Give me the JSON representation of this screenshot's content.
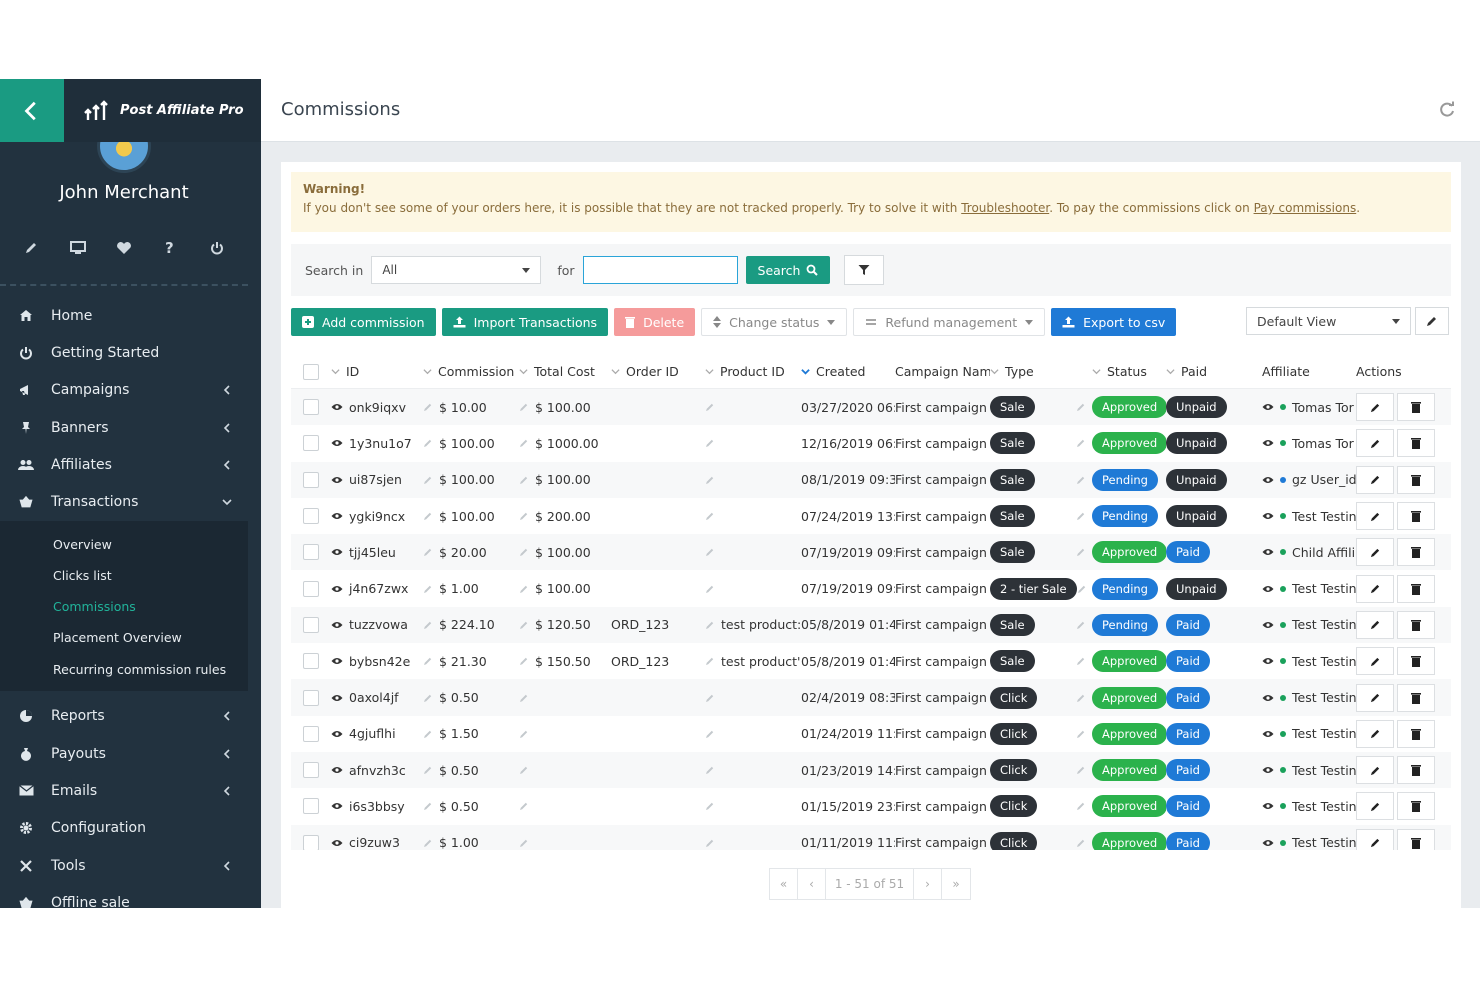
{
  "sidebar": {
    "logo_text": "Post Affiliate Pro",
    "user_name": "John Merchant",
    "menu": [
      {
        "label": "Home",
        "icon": "home-icon"
      },
      {
        "label": "Getting Started",
        "icon": "power-circle-icon"
      },
      {
        "label": "Campaigns",
        "icon": "megaphone-icon"
      },
      {
        "label": "Banners",
        "icon": "pin-icon"
      },
      {
        "label": "Affiliates",
        "icon": "users-icon"
      },
      {
        "label": "Transactions",
        "icon": "basket-icon"
      }
    ],
    "submenu": [
      "Overview",
      "Clicks list",
      "Commissions",
      "Placement Overview",
      "Recurring commission rules"
    ],
    "menu_after": [
      {
        "label": "Reports",
        "icon": "pie-icon"
      },
      {
        "label": "Payouts",
        "icon": "moneybag-icon"
      },
      {
        "label": "Emails",
        "icon": "envelope-icon"
      },
      {
        "label": "Configuration",
        "icon": "gear-icon"
      },
      {
        "label": "Tools",
        "icon": "tools-icon"
      },
      {
        "label": "Offline sale",
        "icon": "basket-icon"
      }
    ]
  },
  "header": {
    "title": "Commissions"
  },
  "warning": {
    "title": "Warning!",
    "text_before": "If you don't see some of your orders here, it is possible that they are not tracked properly. Try to solve it with ",
    "link1": "Troubleshooter",
    "text_middle": ". To pay the commissions click on ",
    "link2": "Pay commissions",
    "text_after": "."
  },
  "search": {
    "search_in_label": "Search in",
    "search_in_value": "All",
    "for_label": "for",
    "input_value": "",
    "button_label": "Search"
  },
  "toolbar": {
    "add": "Add commission",
    "import": "Import Transactions",
    "delete": "Delete",
    "change_status": "Change status",
    "refund": "Refund management",
    "export": "Export to csv",
    "view": "Default View"
  },
  "table": {
    "headers": [
      "ID",
      "Commission",
      "Total Cost",
      "Order ID",
      "Product ID",
      "Created",
      "Campaign Nam",
      "Type",
      "Status",
      "Paid",
      "Affiliate",
      "Actions"
    ],
    "rows": [
      {
        "id": "onk9iqxv",
        "commission": "$ 10.00",
        "total_cost": "$ 100.00",
        "order_id": "",
        "product_id": "",
        "created": "03/27/2020 06::",
        "campaign": "First campaign",
        "type": "Sale",
        "status": "Approved",
        "paid": "Unpaid",
        "affiliate": "Tomas Tor",
        "aff_dot": "g"
      },
      {
        "id": "1y3nu1o7",
        "commission": "$ 100.00",
        "total_cost": "$ 1000.00",
        "order_id": "",
        "product_id": "",
        "created": "12/16/2019 06::",
        "campaign": "First campaign",
        "type": "Sale",
        "status": "Approved",
        "paid": "Unpaid",
        "affiliate": "Tomas Tor",
        "aff_dot": "g"
      },
      {
        "id": "ui87sjen",
        "commission": "$ 100.00",
        "total_cost": "$ 100.00",
        "order_id": "",
        "product_id": "",
        "created": "08/1/2019 09:3(",
        "campaign": "First campaign",
        "type": "Sale",
        "status": "Pending",
        "paid": "Unpaid",
        "affiliate": "gz User_id:",
        "aff_dot": "b"
      },
      {
        "id": "ygki9ncx",
        "commission": "$ 100.00",
        "total_cost": "$ 200.00",
        "order_id": "",
        "product_id": "",
        "created": "07/24/2019 13:(",
        "campaign": "First campaign",
        "type": "Sale",
        "status": "Pending",
        "paid": "Unpaid",
        "affiliate": "Test Testin",
        "aff_dot": "g"
      },
      {
        "id": "tjj45leu",
        "commission": "$ 20.00",
        "total_cost": "$ 100.00",
        "order_id": "",
        "product_id": "",
        "created": "07/19/2019 09:!",
        "campaign": "First campaign",
        "type": "Sale",
        "status": "Approved",
        "paid": "Paid",
        "affiliate": "Child Affili:",
        "aff_dot": "g"
      },
      {
        "id": "j4n67zwx",
        "commission": "$ 1.00",
        "total_cost": "$ 100.00",
        "order_id": "",
        "product_id": "",
        "created": "07/19/2019 09:!",
        "campaign": "First campaign",
        "type": "2 - tier Sale",
        "status": "Pending",
        "paid": "Unpaid",
        "affiliate": "Test Testin",
        "aff_dot": "g"
      },
      {
        "id": "tuzzvowa",
        "commission": "$ 224.10",
        "total_cost": "$ 120.50",
        "order_id": "ORD_123",
        "product_id": "test product:",
        "created": "05/8/2019 01:4!",
        "campaign": "First campaign",
        "type": "Sale",
        "status": "Pending",
        "paid": "Paid",
        "affiliate": "Test Testin",
        "aff_dot": "g"
      },
      {
        "id": "bybsn42e",
        "commission": "$ 21.30",
        "total_cost": "$ 150.50",
        "order_id": "ORD_123",
        "product_id": "test product'",
        "created": "05/8/2019 01:4!",
        "campaign": "First campaign",
        "type": "Sale",
        "status": "Approved",
        "paid": "Paid",
        "affiliate": "Test Testin",
        "aff_dot": "g"
      },
      {
        "id": "0axol4jf",
        "commission": "$ 0.50",
        "total_cost": "",
        "order_id": "",
        "product_id": "",
        "created": "02/4/2019 08:3(",
        "campaign": "First campaign",
        "type": "Click",
        "status": "Approved",
        "paid": "Paid",
        "affiliate": "Test Testin",
        "aff_dot": "g"
      },
      {
        "id": "4gjuflhi",
        "commission": "$ 1.50",
        "total_cost": "",
        "order_id": "",
        "product_id": "",
        "created": "01/24/2019 11:",
        "campaign": "First campaign",
        "type": "Click",
        "status": "Approved",
        "paid": "Paid",
        "affiliate": "Test Testin",
        "aff_dot": "g"
      },
      {
        "id": "afnvzh3c",
        "commission": "$ 0.50",
        "total_cost": "",
        "order_id": "",
        "product_id": "",
        "created": "01/23/2019 14:",
        "campaign": "First campaign",
        "type": "Click",
        "status": "Approved",
        "paid": "Paid",
        "affiliate": "Test Testin",
        "aff_dot": "g"
      },
      {
        "id": "i6s3bbsy",
        "commission": "$ 0.50",
        "total_cost": "",
        "order_id": "",
        "product_id": "",
        "created": "01/15/2019 23::",
        "campaign": "First campaign",
        "type": "Click",
        "status": "Approved",
        "paid": "Paid",
        "affiliate": "Test Testin",
        "aff_dot": "g"
      },
      {
        "id": "ci9zuw3",
        "commission": "$ 1.00",
        "total_cost": "",
        "order_id": "",
        "product_id": "",
        "created": "01/11/2019 11::",
        "campaign": "First campaign",
        "type": "Click",
        "status": "Approved",
        "paid": "Paid",
        "affiliate": "Test Testin",
        "aff_dot": "g"
      }
    ]
  },
  "pagination": {
    "first": "«",
    "prev": "‹",
    "info": "1 - 51 of 51",
    "next": "›",
    "last": "»"
  },
  "colors": {
    "accent": "#1a9b82",
    "sidebar": "#22323f",
    "approved": "#2bb24c",
    "paid_blue": "#1f7ad6",
    "active_link": "#21b39a"
  }
}
